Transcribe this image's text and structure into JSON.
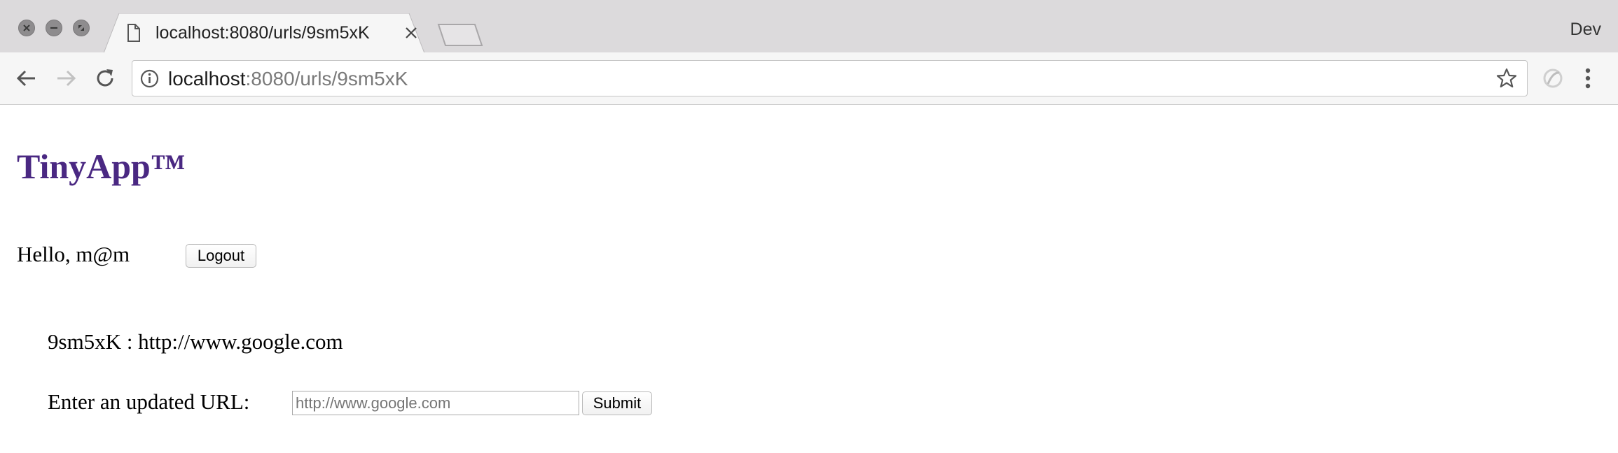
{
  "browser": {
    "tab_title": "localhost:8080/urls/9sm5xK",
    "profile_name": "Dev",
    "address": {
      "host": "localhost",
      "path": ":8080/urls/9sm5xK"
    }
  },
  "page": {
    "brand": "TinyApp™",
    "greeting": "Hello, m@m",
    "logout_label": "Logout",
    "short_url_line": "9sm5xK : http://www.google.com",
    "update_label": "Enter an updated URL:",
    "update_input_placeholder": "http://www.google.com",
    "submit_label": "Submit"
  },
  "colors": {
    "brand": "#4a2882",
    "chrome": "#dcdadc",
    "toolbar": "#f6f6f6"
  }
}
